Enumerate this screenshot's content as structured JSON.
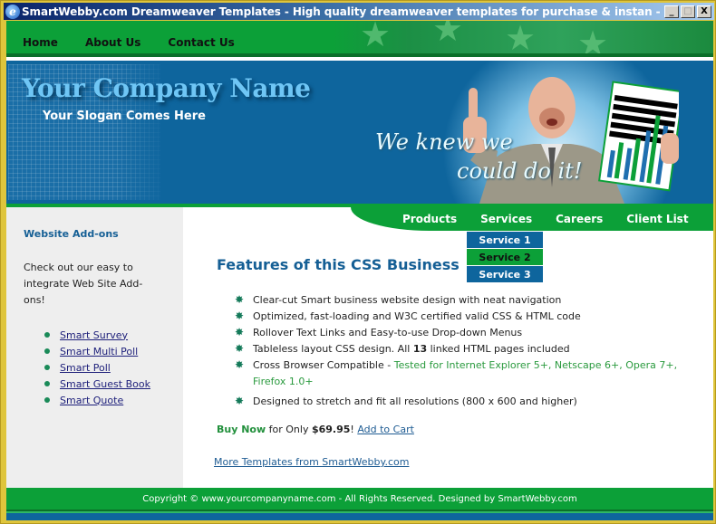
{
  "window": {
    "title": "SmartWebby.com Dreamweaver Templates - High quality dreamweaver templates for purchase & instan - Windows Interne...",
    "icon": "ie-icon",
    "controls": {
      "minimize": "_",
      "maximize": "□",
      "close": "X"
    }
  },
  "topnav": {
    "items": [
      {
        "label": "Home"
      },
      {
        "label": "About Us"
      },
      {
        "label": "Contact Us"
      }
    ]
  },
  "header": {
    "company_name": "Your Company Name",
    "slogan": "Your Slogan Comes Here",
    "tagline_line1": "We knew we",
    "tagline_line2": "could do it!"
  },
  "subnav": {
    "items": [
      {
        "label": "Products"
      },
      {
        "label": "Services"
      },
      {
        "label": "Careers"
      },
      {
        "label": "Client List"
      }
    ],
    "dropdown": {
      "parent": "Services",
      "items": [
        {
          "label": "Service 1",
          "state": "normal"
        },
        {
          "label": "Service 2",
          "state": "hover"
        },
        {
          "label": "Service 3",
          "state": "normal"
        }
      ]
    }
  },
  "sidebar": {
    "title": "Website Add-ons",
    "text": "Check out our easy to integrate Web Site Add-ons!",
    "links": [
      {
        "label": "Smart Survey"
      },
      {
        "label": "Smart Multi Poll"
      },
      {
        "label": "Smart Poll"
      },
      {
        "label": "Smart Guest Book"
      },
      {
        "label": "Smart Quote"
      }
    ]
  },
  "content": {
    "title": "Features of this CSS Business Template",
    "features": [
      {
        "text": "Clear-cut Smart business website design with neat navigation"
      },
      {
        "text": "Optimized, fast-loading and W3C certified valid CSS & HTML code"
      },
      {
        "text": "Rollover Text Links and Easy-to-use Drop-down Menus"
      },
      {
        "text_before": "Tableless layout CSS design. All ",
        "bold": "13",
        "text_after": " linked HTML pages included"
      },
      {
        "text": "Cross Browser Compatible - ",
        "green": "Tested for Internet Explorer 5+, Netscape 6+, Opera 7+, Firefox 1.0+"
      },
      {
        "text": "Designed to stretch and fit all resolutions (800 x 600 and higher)"
      }
    ],
    "buy": {
      "buy_now": "Buy Now",
      "for_only": " for Only ",
      "price": "$69.95",
      "exclaim": "! ",
      "add_to_cart": "Add to Cart"
    },
    "more_link": "More Templates from SmartWebby.com"
  },
  "footer": {
    "text": "Copyright © www.yourcompanyname.com - All Rights Reserved. Designed by SmartWebby.com"
  },
  "colors": {
    "green": "#0ca038",
    "blue": "#0e659d",
    "title_blue": "#155f95",
    "frame_yellow": "#dfc53c"
  }
}
